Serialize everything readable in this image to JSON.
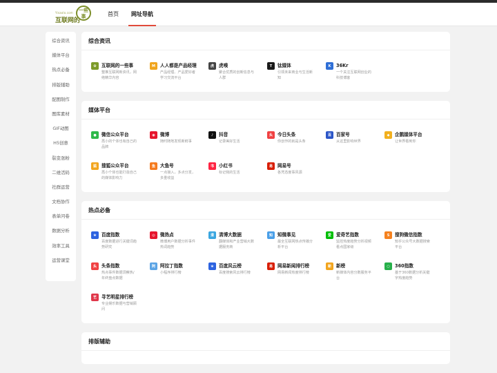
{
  "header": {
    "logo_small": "Yisaolo.com",
    "logo_main": "互联网的",
    "logo_stamp": "一些事",
    "nav": [
      {
        "label": "首页",
        "active": false
      },
      {
        "label": "网址导航",
        "active": true
      }
    ]
  },
  "sidebar": {
    "items": [
      "综合资讯",
      "媒体平台",
      "热点必备",
      "排版辅助",
      "配图制作",
      "图库素材",
      "GIF动图",
      "H5创意",
      "裂变涨粉",
      "二维活码",
      "社群运营",
      "文档协作",
      "表单问卷",
      "数据分析",
      "效率工具",
      "运营课堂"
    ]
  },
  "sections": [
    {
      "title": "综合资讯",
      "sites": [
        {
          "name": "互联网的一些事",
          "desc": "整推互联网新资讯，网络精华内容",
          "icon": "leaf-logo-icon",
          "color": "#7d9b2a"
        },
        {
          "name": "人人都是产品经理",
          "desc": "产品经理、产品爱好者学习交流平台",
          "icon": "m-logo-icon",
          "color": "#f0a51e"
        },
        {
          "name": "虎嗅",
          "desc": "聚合优质的创新信息与人群",
          "icon": "huxiu-logo-icon",
          "color": "#444444"
        },
        {
          "name": "钛媒体",
          "desc": "引领未来商业与生活新知",
          "icon": "tmt-logo-icon",
          "color": "#1a1a1a"
        },
        {
          "name": "36Kr",
          "desc": "一个关注互联网创业的科技博客",
          "icon": "36kr-logo-icon",
          "color": "#2f6fd6"
        }
      ]
    },
    {
      "title": "媒体平台",
      "sites": [
        {
          "name": "微信公众平台",
          "desc": "再小的个体也有自己的品牌",
          "icon": "wechat-logo-icon",
          "color": "#2fb94a"
        },
        {
          "name": "微博",
          "desc": "随时随地发现新鲜事",
          "icon": "weibo-logo-icon",
          "color": "#e6162d"
        },
        {
          "name": "抖音",
          "desc": "记录美好生活",
          "icon": "douyin-logo-icon",
          "color": "#111111"
        },
        {
          "name": "今日头条",
          "desc": "你创作的就是头条",
          "icon": "toutiao-logo-icon",
          "color": "#f04142"
        },
        {
          "name": "百家号",
          "desc": "从这里影响世界",
          "icon": "baijiahao-logo-icon",
          "color": "#2b55c7"
        },
        {
          "name": "企鹅媒体平台",
          "desc": "让世界看到你",
          "icon": "penguin-logo-icon",
          "color": "#f2b01e"
        },
        {
          "name": "搜狐公众平台",
          "desc": "再小个体也能打造自己的媒体影响力",
          "icon": "sohu-logo-icon",
          "color": "#f2a51e"
        },
        {
          "name": "大鱼号",
          "desc": "一点接入，多点分发，多重收益",
          "icon": "dayu-logo-icon",
          "color": "#f57b1f"
        },
        {
          "name": "小红书",
          "desc": "标记我的生活",
          "icon": "xiaohongshu-logo-icon",
          "color": "#ff2442"
        },
        {
          "name": "网易号",
          "desc": "各凭态度事风源",
          "icon": "wangyi-logo-icon",
          "color": "#d81e06"
        }
      ]
    },
    {
      "title": "热点必备",
      "sites": [
        {
          "name": "百度指数",
          "desc": "百度数据进行关键词趋势研究",
          "icon": "baidu-logo-icon",
          "color": "#2d63e0"
        },
        {
          "name": "微热点",
          "desc": "微博用户数据分析事件热词趋势",
          "icon": "weiredian-logo-icon",
          "color": "#e6162d"
        },
        {
          "name": "清博大数据",
          "desc": "翻媒体和产业营销大数据服务商",
          "icon": "qingbo-logo-icon",
          "color": "#3aa6e0"
        },
        {
          "name": "知微事见",
          "desc": "最全互联网热点传播分析平台",
          "icon": "zhiwei-logo-icon",
          "color": "#4a9fe8"
        },
        {
          "name": "爱奇艺指数",
          "desc": "监控热度趋势分析视频看点国家级",
          "icon": "iqiyi-logo-icon",
          "color": "#00be06"
        },
        {
          "name": "搜狗微信指数",
          "desc": "知乎公众号大数据搜索平台",
          "icon": "sogou-logo-icon",
          "color": "#f5821f"
        },
        {
          "name": "头条指数",
          "desc": "热点事件数据洞察热/年终盘点数据",
          "icon": "toutiao-index-logo-icon",
          "color": "#f04142"
        },
        {
          "name": "阿拉丁指数",
          "desc": "小程序排行榜",
          "icon": "aladdin-logo-icon",
          "color": "#5ba4e5"
        },
        {
          "name": "百度风云榜",
          "desc": "百度搜索风云排行榜",
          "icon": "baidu-fengyun-logo-icon",
          "color": "#2d63e0"
        },
        {
          "name": "网易新闻排行榜",
          "desc": "网易新闻热度排行榜",
          "icon": "wangyi-news-logo-icon",
          "color": "#d81e06"
        },
        {
          "name": "新榜",
          "desc": "新媒体内容分数服务平台",
          "icon": "xinbang-logo-icon",
          "color": "#f2a51e"
        },
        {
          "name": "360指数",
          "desc": "基于360数据分析关键字热度趋势",
          "icon": "360-logo-icon",
          "color": "#27b04a"
        },
        {
          "name": "寻艺明星排行榜",
          "desc": "专业娱乐数据与营销顾问",
          "icon": "xunyi-logo-icon",
          "color": "#e0374a"
        }
      ]
    },
    {
      "title": "排版辅助",
      "sites": []
    }
  ]
}
